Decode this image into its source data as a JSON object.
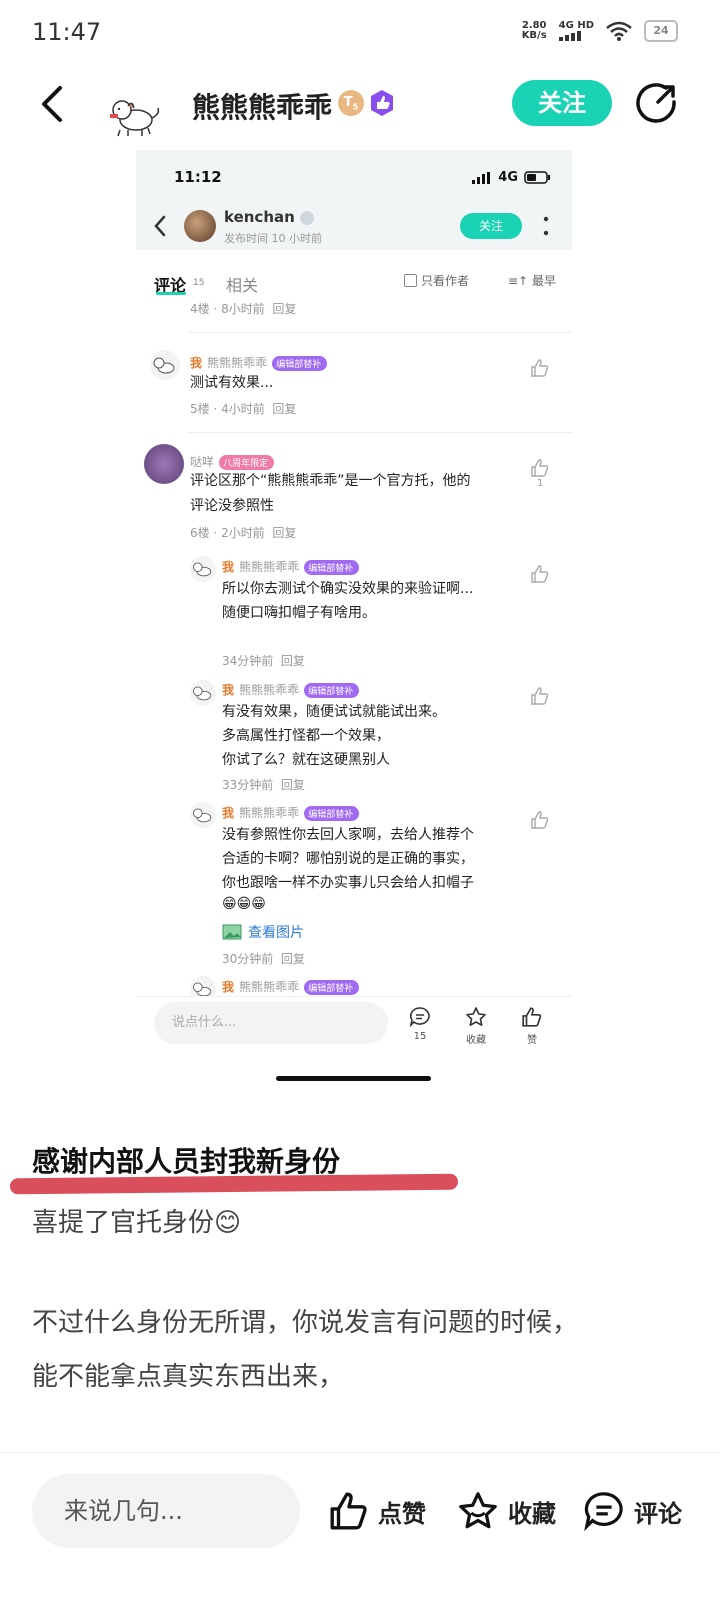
{
  "status_bar": {
    "time": "11:47",
    "speed_value": "2.80",
    "speed_unit": "KB/s",
    "network": "4G HD",
    "battery": "24"
  },
  "header": {
    "author": "熊熊熊乖乖",
    "level_badge": "T",
    "level_num": "5",
    "follow_label": "关注",
    "icons": [
      "back-arrow-icon",
      "share-icon",
      "verified-badge-icon"
    ]
  },
  "screenshot": {
    "time": "11:12",
    "network": "4G",
    "post_author": "kenchan",
    "post_meta": "发布时间 10 小时前",
    "follow_label": "关注",
    "tabs": {
      "comments": "评论",
      "comments_count": "15",
      "related": "相关",
      "only_author": "只看作者",
      "sort": "最早"
    },
    "comments": [
      {
        "meta": "4楼 · 8小时前",
        "reply": "回复"
      },
      {
        "me": "我",
        "user": "熊熊熊乖乖",
        "badge": "编辑部替补",
        "text": [
          "测试有效果..."
        ],
        "meta": "5楼 · 4小时前",
        "reply": "回复"
      },
      {
        "user": "哒咩",
        "badge": "八周年限定",
        "text": [
          "评论区那个“熊熊熊乖乖”是一个官方托，他的",
          "评论没参照性"
        ],
        "likes": "1",
        "meta": "6楼 · 2小时前",
        "reply": "回复"
      }
    ],
    "replies": [
      {
        "me": "我",
        "user": "熊熊熊乖乖",
        "badge": "编辑部替补",
        "text": [
          "所以你去测试个确实没效果的来验证啊...",
          "随便口嗨扣帽子有啥用。"
        ],
        "meta": "34分钟前",
        "reply": "回复"
      },
      {
        "me": "我",
        "user": "熊熊熊乖乖",
        "badge": "编辑部替补",
        "text": [
          "有没有效果，随便试试就能试出来。",
          "多高属性打怪都一个效果，",
          "你试了么？就在这硬黑别人"
        ],
        "meta": "33分钟前",
        "reply": "回复"
      },
      {
        "me": "我",
        "user": "熊熊熊乖乖",
        "badge": "编辑部替补",
        "text": [
          "没有参照性你去回人家啊，去给人推荐个",
          "合适的卡啊？哪怕别说的是正确的事实，",
          "你也跟啥一样不办实事儿只会给人扣帽子"
        ],
        "emojis": "😁😁😁",
        "image_link": "查看图片",
        "meta": "30分钟前",
        "reply": "回复"
      },
      {
        "me": "我",
        "user": "熊熊熊乖乖",
        "badge": "编辑部替补"
      }
    ],
    "bottom": {
      "placeholder": "说点什么...",
      "comment_count": "15",
      "collect": "收藏",
      "like": "赞"
    }
  },
  "post": {
    "title": "感谢内部人员封我新身份",
    "line1": "喜提了官托身份😊",
    "line2": "不过什么身份无所谓，你说发言有问题的时候，",
    "line3": "能不能拿点真实东西出来，"
  },
  "bottom_bar": {
    "placeholder": "来说几句...",
    "like": "点赞",
    "collect": "收藏",
    "comment": "评论"
  },
  "colors": {
    "accent": "#19d3b4",
    "badge_purple": "#a06af2",
    "highlight": "#d94f5c",
    "me_orange": "#e8792b"
  }
}
